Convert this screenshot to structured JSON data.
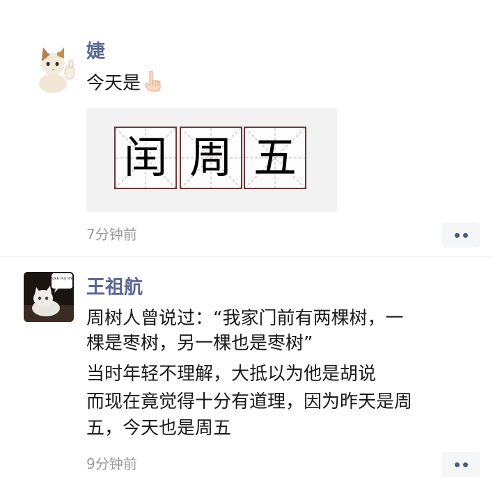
{
  "posts": [
    {
      "username": "婕",
      "text_line_1": "今天是",
      "pointing_emoji": "hand-pointing-down-icon",
      "image_chars": [
        "闰",
        "周",
        "五"
      ],
      "timestamp": "7分钟前",
      "avatar_icon": "cat-avatar-icon"
    },
    {
      "username": "王祖航",
      "lines": [
        "周树人曾说过：“我家门前有两棵树，一",
        "棵是枣树，另一棵也是枣树”",
        "当时年轻不理解，大抵以为他是胡说",
        "而现在竟觉得十分有道理，因为昨天是周",
        "五，今天也是周五"
      ],
      "timestamp": "9分钟前",
      "avatar_icon": "kitten-avatar-icon",
      "avatar_caption": "fukk my life"
    }
  ],
  "colors": {
    "username": "#5a6a96",
    "timestamp": "#9a9a9a",
    "more_dots": "#4a5a82",
    "grid_border": "#6b3a3a"
  }
}
